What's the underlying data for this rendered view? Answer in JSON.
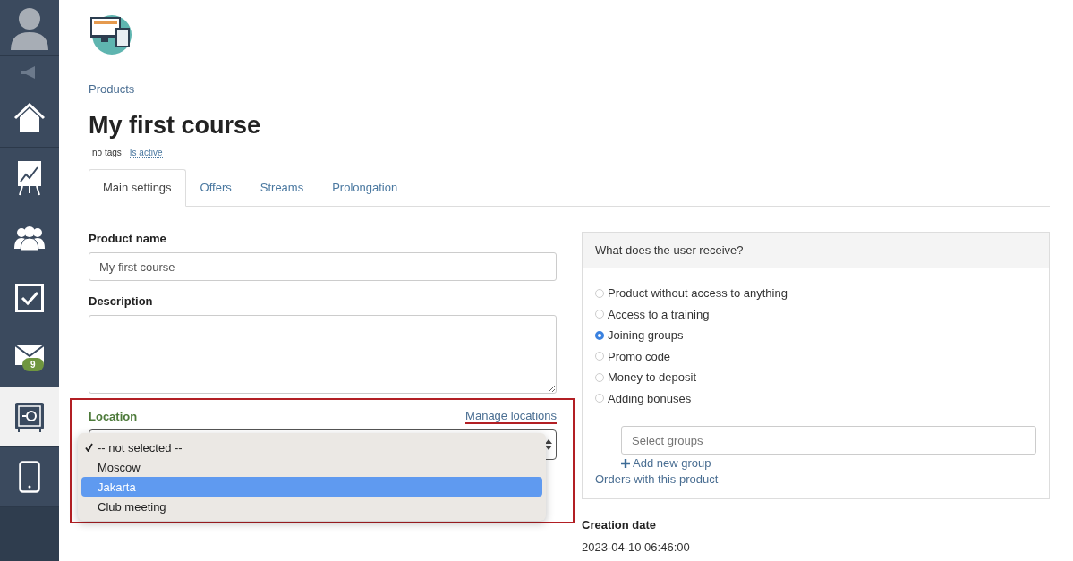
{
  "sidebar": {
    "items": [
      {
        "kind": "avatar",
        "selected": false
      },
      {
        "kind": "megaphone",
        "selected": false
      },
      {
        "kind": "home",
        "selected": false
      },
      {
        "kind": "chart",
        "selected": false
      },
      {
        "kind": "people",
        "selected": false
      },
      {
        "kind": "check",
        "selected": false
      },
      {
        "kind": "mail",
        "selected": false,
        "badge": "9"
      },
      {
        "kind": "safe",
        "selected": true
      },
      {
        "kind": "phone",
        "selected": false
      }
    ]
  },
  "breadcrumb": "Products",
  "title": "My first course",
  "tags": {
    "label": "no tags",
    "status": "Is active"
  },
  "tabs": [
    {
      "label": "Main settings",
      "selected": true
    },
    {
      "label": "Offers",
      "selected": false
    },
    {
      "label": "Streams",
      "selected": false
    },
    {
      "label": "Prolongation",
      "selected": false
    }
  ],
  "product_name": {
    "label": "Product name",
    "value": "My first course"
  },
  "description": {
    "label": "Description"
  },
  "location": {
    "label": "Location",
    "manage_link": "Manage locations",
    "options": [
      {
        "label": "-- not selected --",
        "checked": true,
        "selected": false
      },
      {
        "label": "Moscow",
        "checked": false,
        "selected": false
      },
      {
        "label": "Jakarta",
        "checked": false,
        "selected": true
      },
      {
        "label": "Club meeting",
        "checked": false,
        "selected": false
      }
    ]
  },
  "receive_panel": {
    "title": "What does the user receive?",
    "options": [
      {
        "label": "Product without access to anything",
        "selected": false
      },
      {
        "label": "Access to a training",
        "selected": false
      },
      {
        "label": "Joining groups",
        "selected": true
      },
      {
        "label": "Promo code",
        "selected": false
      },
      {
        "label": "Money to deposit",
        "selected": false
      },
      {
        "label": "Adding bonuses",
        "selected": false
      }
    ],
    "groups_placeholder": "Select groups",
    "add_group": "Add new group",
    "orders_link": "Orders with this product"
  },
  "creation_date": {
    "label": "Creation date",
    "value": "2023-04-10 06:46:00"
  }
}
